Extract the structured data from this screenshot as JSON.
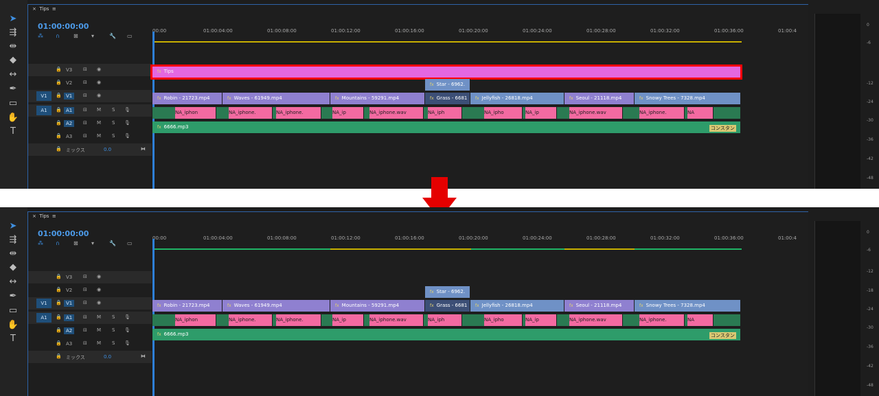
{
  "panels": [
    {
      "id": "before",
      "tab": "Tips",
      "timecode": "01:00:00:00",
      "ruler": [
        "00:00",
        "01:00:04:00",
        "01:00:08:00",
        "01:00:12:00",
        "01:00:16:00",
        "01:00:20:00",
        "01:00:24:00",
        "01:00:28:00",
        "01:00:32:00",
        "01:00:36:00",
        "01:00:4"
      ],
      "tracks": {
        "v3": "V3",
        "v2": "V2",
        "v1": "V1",
        "src_v1": "V1",
        "a1": "A1",
        "src_a1": "A1",
        "a2": "A2",
        "a3": "A3",
        "mix": "ミックス",
        "mix_value": "0.0",
        "m": "M",
        "s": "S"
      },
      "title_clip": "Tips",
      "star_clip": "Star - 6962.",
      "v1_clips": [
        "Robin - 21723.mp4",
        "Waves - 61949.mp4",
        "Mountains - 59291.mp4",
        "Grass - 6681",
        "Jellyfish - 26818.mp4",
        "Seoul - 21118.mp4",
        "Snowy Trees - 7328.mp4"
      ],
      "a1_clips": [
        "NA_iphon",
        "NA_iphone.",
        "NA_iphone.",
        "NA_ip",
        "NA_iphone.wav",
        "NA_iph",
        "NA_ipho",
        "NA_ip",
        "NA_iphone.wav",
        "NA_iphone.",
        "NA"
      ],
      "a2_clip": "6666.mp3",
      "const_label": "コンスタン"
    },
    {
      "id": "after",
      "tab": "Tips",
      "timecode": "01:00:00:00",
      "ruler": [
        "00:00",
        "01:00:04:00",
        "01:00:08:00",
        "01:00:12:00",
        "01:00:16:00",
        "01:00:20:00",
        "01:00:24:00",
        "01:00:28:00",
        "01:00:32:00",
        "01:00:36:00",
        "01:00:4"
      ],
      "tracks": {
        "v3": "V3",
        "v2": "V2",
        "v1": "V1",
        "src_v1": "V1",
        "a1": "A1",
        "src_a1": "A1",
        "a2": "A2",
        "a3": "A3",
        "mix": "ミックス",
        "mix_value": "0.0",
        "m": "M",
        "s": "S"
      },
      "star_clip": "Star - 6962.",
      "v1_clips": [
        "Robin - 21723.mp4",
        "Waves - 61949.mp4",
        "Mountains - 59291.mp4",
        "Grass - 6681",
        "Jellyfish - 26818.mp4",
        "Seoul - 21118.mp4",
        "Snowy Trees - 7328.mp4"
      ],
      "a1_clips": [
        "NA_iphon",
        "NA_iphone.",
        "NA_iphone.",
        "NA_ip",
        "NA_iphone.wav",
        "NA_iph",
        "NA_ipho",
        "NA_ip",
        "NA_iphone.wav",
        "NA_iphone.",
        "NA"
      ],
      "a2_clip": "6666.mp3",
      "const_label": "コンスタン"
    }
  ],
  "meter_db": [
    "0",
    "-6",
    "-12",
    "-18",
    "-24",
    "-30",
    "-36",
    "-42",
    "-48"
  ],
  "colors": {
    "accent": "#3d8fe2",
    "arrow": "#e50000",
    "highlight_box": "#ff0000"
  }
}
